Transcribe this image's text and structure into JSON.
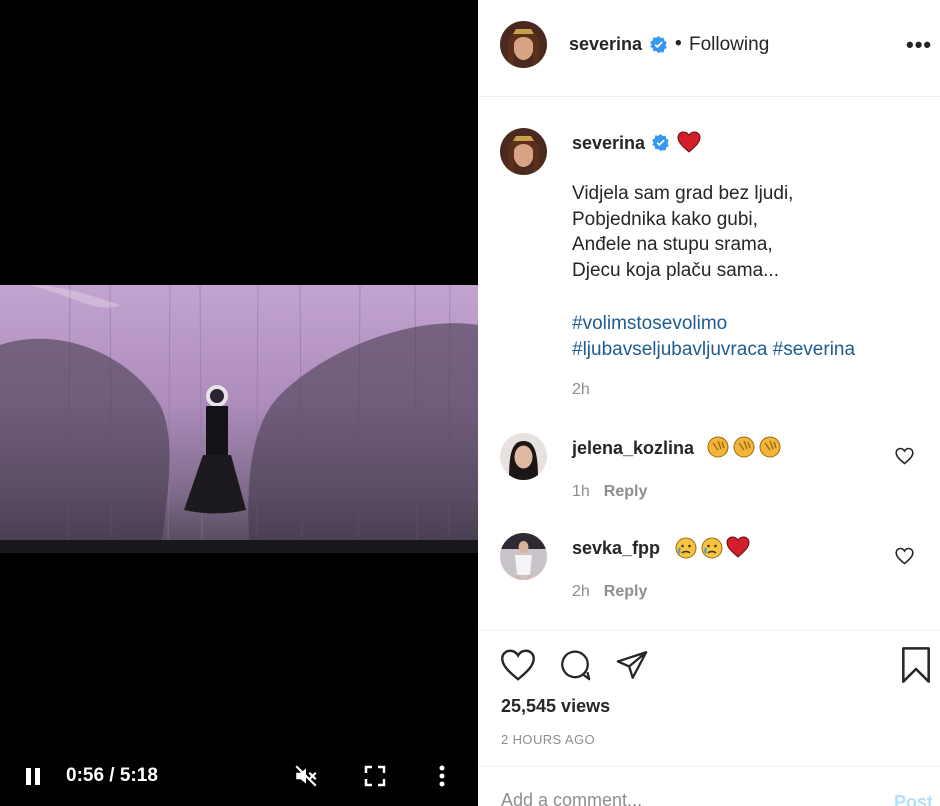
{
  "video": {
    "time_display": "0:56 / 5:18",
    "pause_icon": "pause-icon",
    "mute_icon": "muted-speaker-icon",
    "fullscreen_icon": "fullscreen-icon",
    "more_icon": "more-vertical-icon"
  },
  "header": {
    "username": "severina",
    "separator": "•",
    "follow_status": "Following",
    "options": "•••"
  },
  "caption": {
    "username": "severina",
    "lines": [
      "Vidjela sam grad bez ljudi,",
      "Pobjednika kako gubi,",
      "Anđele na stupu srama,",
      "Djecu koja plaču sama..."
    ],
    "hashtags_line1": [
      "#volimstosevolimo"
    ],
    "hashtags_line2": [
      "#ljubavseljubavljuvraca",
      "#severina"
    ],
    "time": "2h"
  },
  "comments": [
    {
      "username": "jelena_kozlina",
      "emojis": [
        "clapping-hands-emoji",
        "clapping-hands-emoji",
        "clapping-hands-emoji"
      ],
      "time": "1h",
      "reply": "Reply"
    },
    {
      "username": "sevka_fpp",
      "emojis": [
        "crying-face-emoji",
        "crying-face-emoji",
        "red-heart-emoji"
      ],
      "time": "2h",
      "reply": "Reply"
    }
  ],
  "stats": {
    "views": "25,545 views",
    "posted_ago": "2 HOURS AGO"
  },
  "add_comment": {
    "placeholder": "Add a comment...",
    "post_label": "Post"
  },
  "colors": {
    "verified_blue": "#3897f0",
    "hashtag_blue": "#1e5b92",
    "heart_red": "#d21f2c",
    "post_disabled": "#b2dffc"
  }
}
